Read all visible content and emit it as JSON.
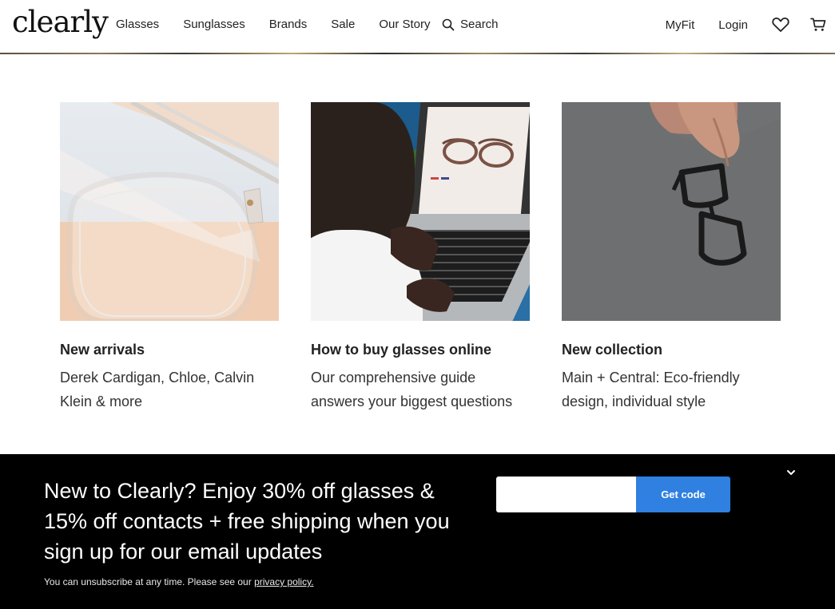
{
  "brand": {
    "logo_text": "clearly"
  },
  "nav": {
    "items": [
      {
        "label": "Glasses"
      },
      {
        "label": "Sunglasses"
      },
      {
        "label": "Brands"
      },
      {
        "label": "Sale"
      },
      {
        "label": "Our Story"
      }
    ],
    "search_label": "Search",
    "myfit_label": "MyFit",
    "login_label": "Login"
  },
  "cards": [
    {
      "title": "New arrivals",
      "description": "Derek Cardigan, Chloe, Calvin Klein & more"
    },
    {
      "title": "How to buy glasses online",
      "description": "Our comprehensive guide answers your biggest questions"
    },
    {
      "title": "New collection",
      "description": "Main + Central: Eco-friendly design, individual style"
    }
  ],
  "banner": {
    "headline": "New to Clearly? Enjoy 30% off glasses & 15% off contacts + free shipping when you sign up for our email updates",
    "note_prefix": "You can unsubscribe at any time. Please see our ",
    "privacy_link": "privacy policy.",
    "email_placeholder": "",
    "button_label": "Get code"
  },
  "colors": {
    "accent": "#2f80e0",
    "banner_bg": "#000000"
  },
  "icons": [
    "search-icon",
    "heart-icon",
    "cart-icon",
    "chevron-down-icon"
  ]
}
